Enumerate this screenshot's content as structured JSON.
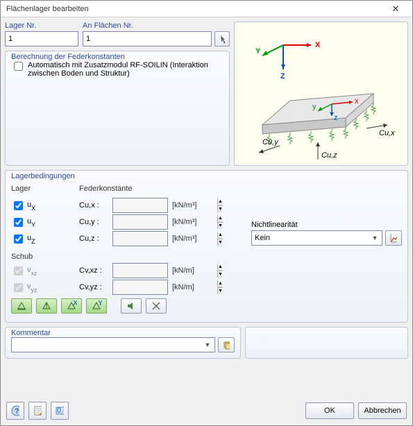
{
  "title": "Flächenlager bearbeiten",
  "lagerNrLabel": "Lager Nr.",
  "lagerNr": "1",
  "anFlaechenLabel": "An Flächen Nr.",
  "anFlaechen": "1",
  "berechnungLegend": "Berechnung der Federkonstanten",
  "rfsoilinLabel": "Automatisch mit Zusatzmodul RF-SOILIN (Interaktion zwischen Boden und Struktur)",
  "lagerbedLegend": "Lagerbedingungen",
  "lagerHead": "Lager",
  "federHead": "Federkonstante",
  "schubHead": "Schub",
  "nichtlinLabel": "Nichtlinearität",
  "nichtlinValue": "Kein",
  "ux": {
    "main": "u",
    "sub": "X",
    "c": "Cu,x :",
    "unit": "[kN/m³]",
    "val": ""
  },
  "uy": {
    "main": "u",
    "sub": "Y",
    "c": "Cu,y :",
    "unit": "[kN/m³]",
    "val": ""
  },
  "uz": {
    "main": "u",
    "sub": "Z",
    "c": "Cu,z :",
    "unit": "[kN/m³]",
    "val": ""
  },
  "vxz": {
    "main": "v",
    "sub": "xz",
    "c": "Cv,xz :",
    "unit": "[kN/m]",
    "val": ""
  },
  "vyz": {
    "main": "v",
    "sub": "yz",
    "c": "Cv,yz :",
    "unit": "[kN/m]",
    "val": ""
  },
  "kommentarLegend": "Kommentar",
  "kommentar": "",
  "ok": "OK",
  "cancel": "Abbrechen",
  "diagramY": "Y",
  "diagramX": "X",
  "diagramZ": "Z",
  "diagCux": "Cu,x",
  "diagCuy": "Cu,y",
  "diagCuz": "Cu,z",
  "diagLx": "x",
  "diagLy": "y",
  "diagLz": "z"
}
